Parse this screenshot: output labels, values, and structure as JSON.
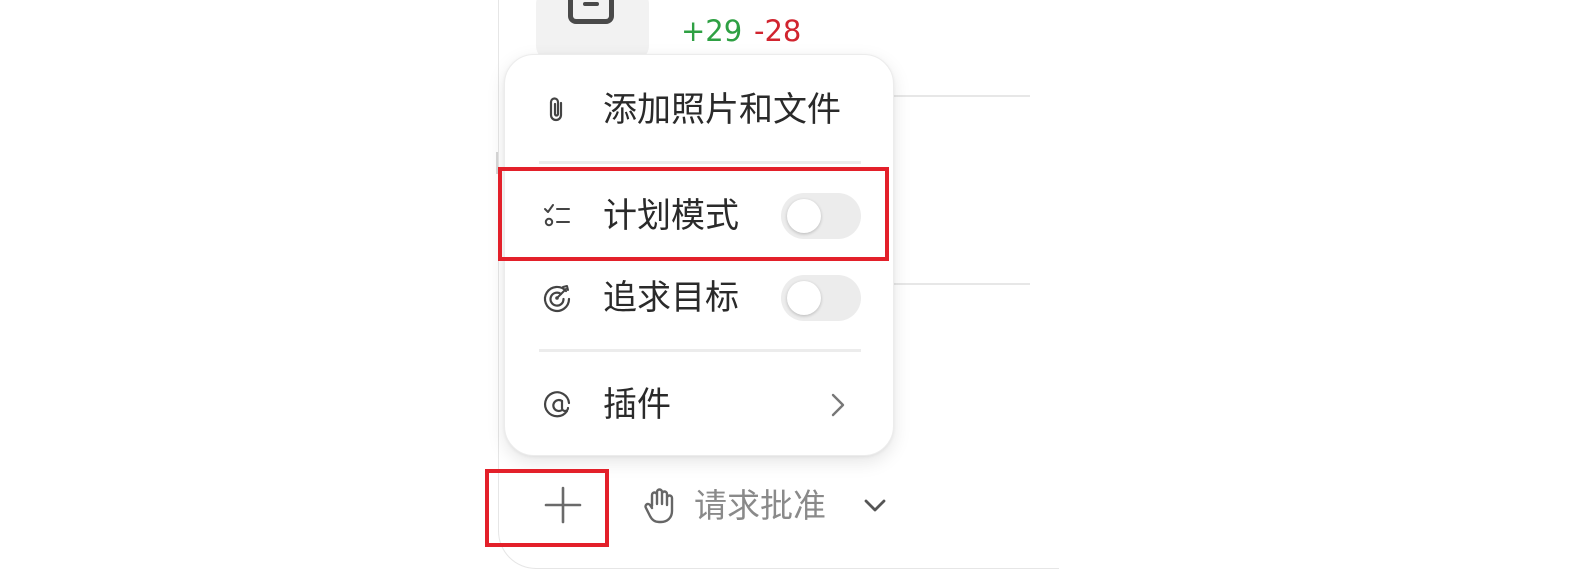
{
  "diff": {
    "added": "+29",
    "removed": "-28"
  },
  "menu": {
    "items": [
      {
        "id": "attach",
        "label": "添加照片和文件",
        "icon": "paperclip-icon"
      },
      {
        "id": "plan",
        "label": "计划模式",
        "icon": "checklist-icon",
        "toggle_on": false
      },
      {
        "id": "goal",
        "label": "追求目标",
        "icon": "target-icon",
        "toggle_on": false
      },
      {
        "id": "plugins",
        "label": "插件",
        "icon": "plugin-icon"
      }
    ]
  },
  "composer": {
    "add_icon": "plus-icon",
    "approval_label": "请求批准",
    "approval_icon": "hand-icon"
  },
  "colors": {
    "added": "#2ea043",
    "removed": "#d1242f",
    "highlight": "#e3202a",
    "toggle_off": "#ececec"
  }
}
